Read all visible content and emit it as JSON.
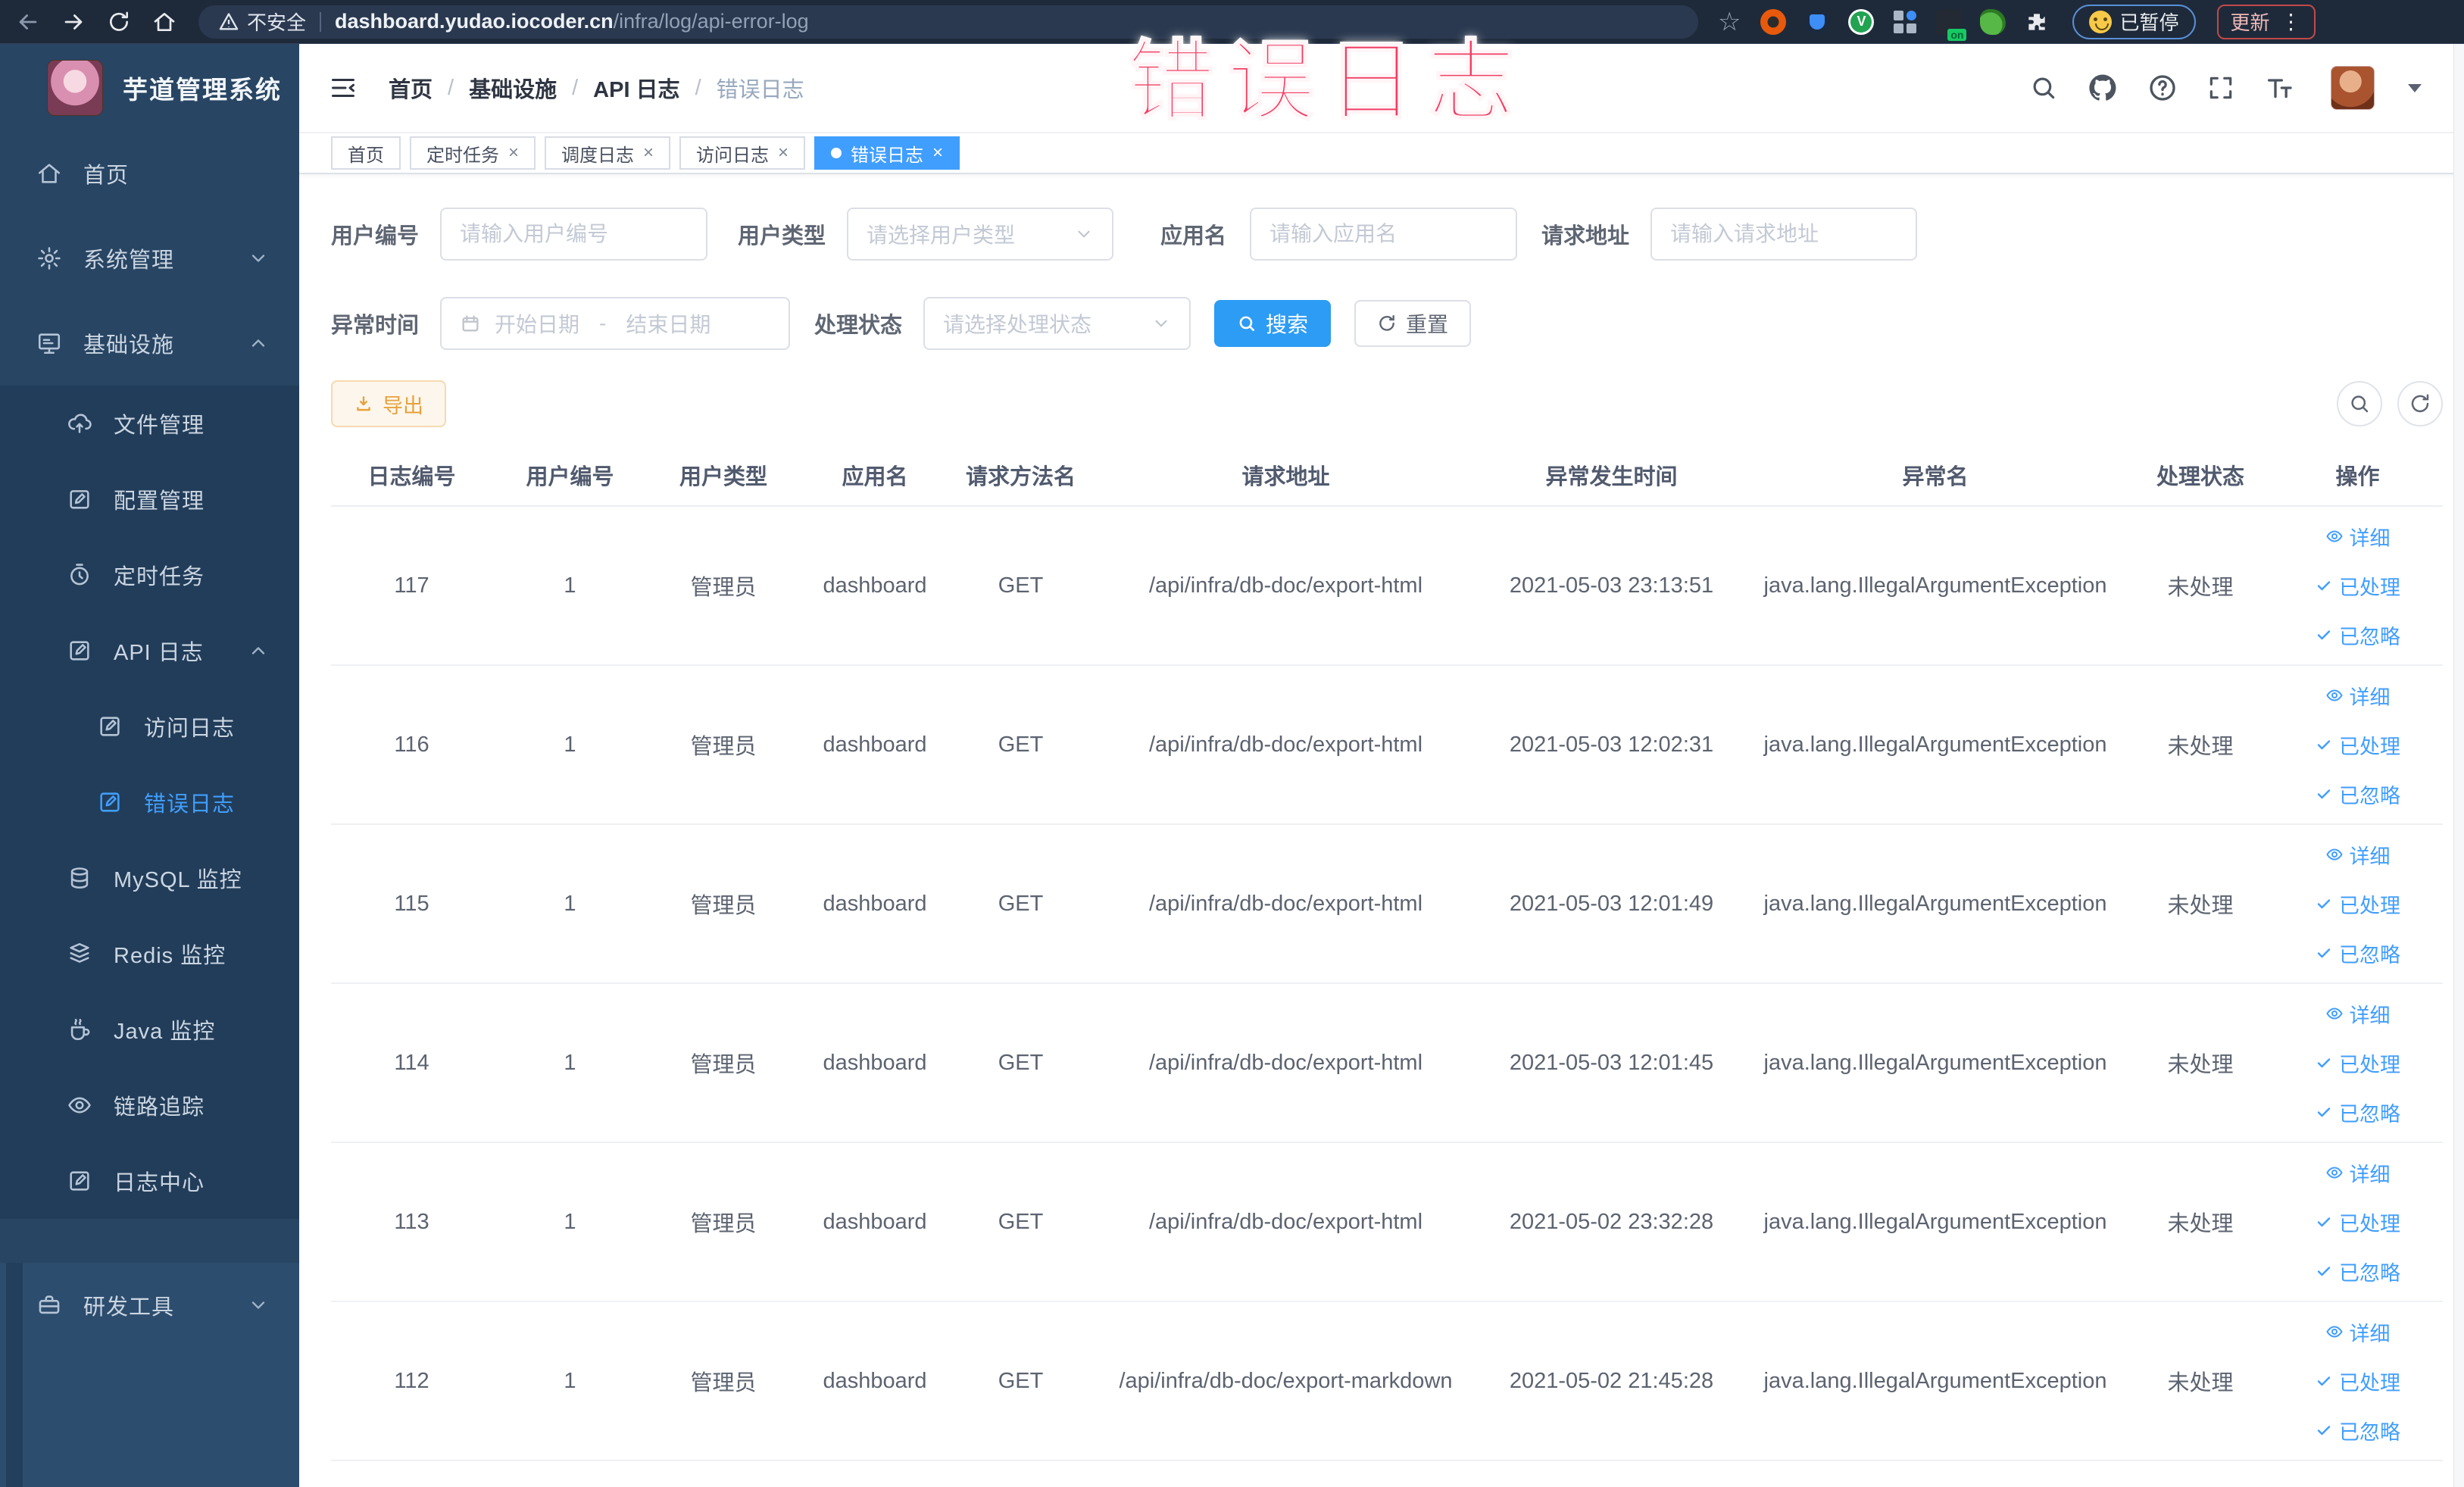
{
  "browser": {
    "security_label": "不安全",
    "url_host": "dashboard.yudao.iocoder.cn",
    "url_path": "/infra/log/api-error-log",
    "paused_label": "已暂停",
    "update_label": "更新",
    "menu_dots": "⋮",
    "star": "☆"
  },
  "overlay": {
    "text": "错误日志",
    "color": "#f23c63"
  },
  "sidebar": {
    "title": "芋道管理系统",
    "items": [
      {
        "key": "home",
        "label": "首页",
        "icon": "home-icon",
        "level": 1
      },
      {
        "key": "system",
        "label": "系统管理",
        "icon": "gear-icon",
        "level": 1,
        "chevron": "down"
      },
      {
        "key": "infra",
        "label": "基础设施",
        "icon": "infra-icon",
        "level": 1,
        "chevron": "up"
      },
      {
        "key": "file",
        "label": "文件管理",
        "icon": "cloud-upload-icon",
        "level": 2
      },
      {
        "key": "config",
        "label": "配置管理",
        "icon": "edit-icon",
        "level": 2
      },
      {
        "key": "job",
        "label": "定时任务",
        "icon": "timer-icon",
        "level": 2
      },
      {
        "key": "api-log",
        "label": "API 日志",
        "icon": "log-icon",
        "level": 2,
        "chevron": "up"
      },
      {
        "key": "access-log",
        "label": "访问日志",
        "icon": "log-icon",
        "level": 3
      },
      {
        "key": "error-log",
        "label": "错误日志",
        "icon": "log-icon",
        "level": 3,
        "active": true
      },
      {
        "key": "mysql",
        "label": "MySQL 监控",
        "icon": "mysql-icon",
        "level": 2
      },
      {
        "key": "redis",
        "label": "Redis 监控",
        "icon": "redis-icon",
        "level": 2
      },
      {
        "key": "java",
        "label": "Java 监控",
        "icon": "java-icon",
        "level": 2
      },
      {
        "key": "trace",
        "label": "链路追踪",
        "icon": "trace-icon",
        "level": 2
      },
      {
        "key": "log-center",
        "label": "日志中心",
        "icon": "log-icon",
        "level": 2
      },
      {
        "key": "dev-tools",
        "label": "研发工具",
        "icon": "tools-icon",
        "level": 1,
        "chevron": "down",
        "section": "bottom"
      }
    ]
  },
  "breadcrumb": {
    "items": [
      "首页",
      "基础设施",
      "API 日志",
      "错误日志"
    ],
    "separator": "/"
  },
  "tabs": [
    {
      "label": "首页",
      "closable": false,
      "active": false
    },
    {
      "label": "定时任务",
      "closable": true,
      "active": false
    },
    {
      "label": "调度日志",
      "closable": true,
      "active": false
    },
    {
      "label": "访问日志",
      "closable": true,
      "active": false
    },
    {
      "label": "错误日志",
      "closable": true,
      "active": true
    }
  ],
  "filters": {
    "user_id": {
      "label": "用户编号",
      "placeholder": "请输入用户编号"
    },
    "user_type": {
      "label": "用户类型",
      "placeholder": "请选择用户类型"
    },
    "app_name": {
      "label": "应用名",
      "placeholder": "请输入应用名"
    },
    "request_url": {
      "label": "请求地址",
      "placeholder": "请输入请求地址"
    },
    "exception_time": {
      "label": "异常时间",
      "start_placeholder": "开始日期",
      "separator": "-",
      "end_placeholder": "结束日期"
    },
    "process_status": {
      "label": "处理状态",
      "placeholder": "请选择处理状态"
    },
    "search_label": "搜索",
    "reset_label": "重置"
  },
  "toolbar": {
    "export_label": "导出"
  },
  "table": {
    "columns": [
      {
        "key": "id",
        "label": "日志编号"
      },
      {
        "key": "user_id",
        "label": "用户编号"
      },
      {
        "key": "user_type",
        "label": "用户类型"
      },
      {
        "key": "app",
        "label": "应用名"
      },
      {
        "key": "method",
        "label": "请求方法名"
      },
      {
        "key": "url",
        "label": "请求地址"
      },
      {
        "key": "time",
        "label": "异常发生时间"
      },
      {
        "key": "exception",
        "label": "异常名"
      },
      {
        "key": "status",
        "label": "处理状态"
      },
      {
        "key": "ops",
        "label": "操作"
      }
    ],
    "row_actions": [
      {
        "label": "详细",
        "icon": "eye-icon"
      },
      {
        "label": "已处理",
        "icon": "check-icon"
      },
      {
        "label": "已忽略",
        "icon": "check-icon"
      }
    ],
    "rows": [
      {
        "id": "117",
        "user_id": "1",
        "user_type": "管理员",
        "app": "dashboard",
        "method": "GET",
        "url": "/api/infra/db-doc/export-html",
        "time": "2021-05-03 23:13:51",
        "exception": "java.lang.IllegalArgumentException",
        "status": "未处理"
      },
      {
        "id": "116",
        "user_id": "1",
        "user_type": "管理员",
        "app": "dashboard",
        "method": "GET",
        "url": "/api/infra/db-doc/export-html",
        "time": "2021-05-03 12:02:31",
        "exception": "java.lang.IllegalArgumentException",
        "status": "未处理"
      },
      {
        "id": "115",
        "user_id": "1",
        "user_type": "管理员",
        "app": "dashboard",
        "method": "GET",
        "url": "/api/infra/db-doc/export-html",
        "time": "2021-05-03 12:01:49",
        "exception": "java.lang.IllegalArgumentException",
        "status": "未处理"
      },
      {
        "id": "114",
        "user_id": "1",
        "user_type": "管理员",
        "app": "dashboard",
        "method": "GET",
        "url": "/api/infra/db-doc/export-html",
        "time": "2021-05-03 12:01:45",
        "exception": "java.lang.IllegalArgumentException",
        "status": "未处理"
      },
      {
        "id": "113",
        "user_id": "1",
        "user_type": "管理员",
        "app": "dashboard",
        "method": "GET",
        "url": "/api/infra/db-doc/export-html",
        "time": "2021-05-02 23:32:28",
        "exception": "java.lang.IllegalArgumentException",
        "status": "未处理"
      },
      {
        "id": "112",
        "user_id": "1",
        "user_type": "管理员",
        "app": "dashboard",
        "method": "GET",
        "url": "/api/infra/db-doc/export-markdown",
        "time": "2021-05-02 21:45:28",
        "exception": "java.lang.IllegalArgumentException",
        "status": "未处理"
      }
    ]
  },
  "colors": {
    "primary": "#409eff",
    "warning": "#e6a23c",
    "overlay_pink": "#f23c63",
    "sidebar_bg": "#284563",
    "submenu_bg": "#223d59",
    "sidebar_bottom_bg": "#2d4d6e",
    "browser_bg": "#1e2a3a"
  }
}
